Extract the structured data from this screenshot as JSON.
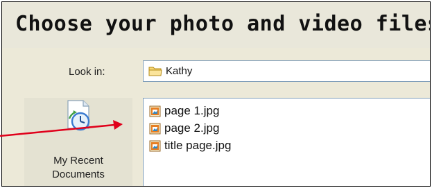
{
  "dialog": {
    "title": "Choose your photo and video files",
    "look_in": {
      "label": "Look in:",
      "value": "Kathy",
      "icon": "folder-icon"
    },
    "places": [
      {
        "label_line1": "My Recent",
        "label_line2": "Documents",
        "icon": "recent-documents-icon"
      }
    ],
    "files": [
      {
        "name": "page 1.jpg",
        "icon": "jpg-file-icon"
      },
      {
        "name": "page 2.jpg",
        "icon": "jpg-file-icon"
      },
      {
        "name": "title page.jpg",
        "icon": "jpg-file-icon"
      }
    ]
  },
  "annotation": {
    "arrow_color": "#e0001b"
  },
  "colors": {
    "dialog_background": "#ece9d8",
    "field_border": "#7f9db9"
  }
}
